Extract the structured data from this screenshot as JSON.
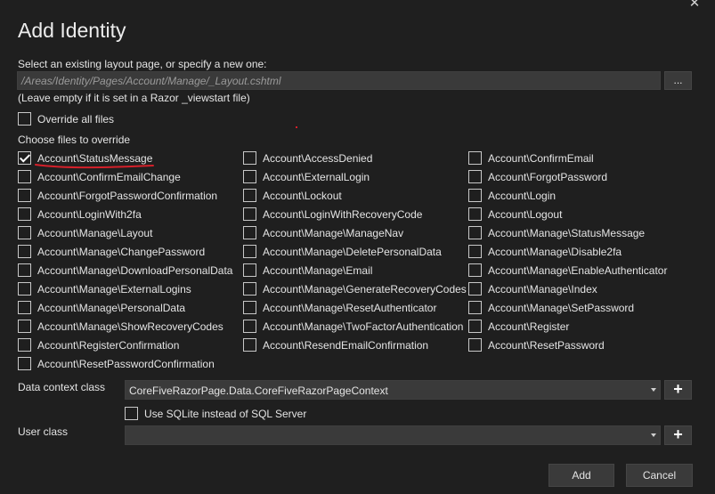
{
  "dialog": {
    "title": "Add Identity",
    "close_glyph": "✕"
  },
  "layout": {
    "label": "Select an existing layout page, or specify a new one:",
    "value": "/Areas/Identity/Pages/Account/Manage/_Layout.cshtml",
    "browse_label": "...",
    "hint": "(Leave empty if it is set in a Razor _viewstart file)"
  },
  "override_all": {
    "label": "Override all files",
    "checked": false
  },
  "choose_label": "Choose files to override",
  "files": [
    {
      "label": "Account\\StatusMessage",
      "checked": true
    },
    {
      "label": "Account\\AccessDenied",
      "checked": false
    },
    {
      "label": "Account\\ConfirmEmail",
      "checked": false
    },
    {
      "label": "Account\\ConfirmEmailChange",
      "checked": false
    },
    {
      "label": "Account\\ExternalLogin",
      "checked": false
    },
    {
      "label": "Account\\ForgotPassword",
      "checked": false
    },
    {
      "label": "Account\\ForgotPasswordConfirmation",
      "checked": false
    },
    {
      "label": "Account\\Lockout",
      "checked": false
    },
    {
      "label": "Account\\Login",
      "checked": false
    },
    {
      "label": "Account\\LoginWith2fa",
      "checked": false
    },
    {
      "label": "Account\\LoginWithRecoveryCode",
      "checked": false
    },
    {
      "label": "Account\\Logout",
      "checked": false
    },
    {
      "label": "Account\\Manage\\Layout",
      "checked": false
    },
    {
      "label": "Account\\Manage\\ManageNav",
      "checked": false
    },
    {
      "label": "Account\\Manage\\StatusMessage",
      "checked": false
    },
    {
      "label": "Account\\Manage\\ChangePassword",
      "checked": false
    },
    {
      "label": "Account\\Manage\\DeletePersonalData",
      "checked": false
    },
    {
      "label": "Account\\Manage\\Disable2fa",
      "checked": false
    },
    {
      "label": "Account\\Manage\\DownloadPersonalData",
      "checked": false
    },
    {
      "label": "Account\\Manage\\Email",
      "checked": false
    },
    {
      "label": "Account\\Manage\\EnableAuthenticator",
      "checked": false
    },
    {
      "label": "Account\\Manage\\ExternalLogins",
      "checked": false
    },
    {
      "label": "Account\\Manage\\GenerateRecoveryCodes",
      "checked": false
    },
    {
      "label": "Account\\Manage\\Index",
      "checked": false
    },
    {
      "label": "Account\\Manage\\PersonalData",
      "checked": false
    },
    {
      "label": "Account\\Manage\\ResetAuthenticator",
      "checked": false
    },
    {
      "label": "Account\\Manage\\SetPassword",
      "checked": false
    },
    {
      "label": "Account\\Manage\\ShowRecoveryCodes",
      "checked": false
    },
    {
      "label": "Account\\Manage\\TwoFactorAuthentication",
      "checked": false
    },
    {
      "label": "Account\\Register",
      "checked": false
    },
    {
      "label": "Account\\RegisterConfirmation",
      "checked": false
    },
    {
      "label": "Account\\ResendEmailConfirmation",
      "checked": false
    },
    {
      "label": "Account\\ResetPassword",
      "checked": false
    },
    {
      "label": "Account\\ResetPasswordConfirmation",
      "checked": false
    }
  ],
  "data_context": {
    "label": "Data context class",
    "value": "CoreFiveRazorPage.Data.CoreFiveRazorPageContext",
    "add_label": "+"
  },
  "sqlite": {
    "label": "Use SQLite instead of SQL Server",
    "checked": false
  },
  "user_class": {
    "label": "User class",
    "value": "",
    "add_label": "+"
  },
  "actions": {
    "add_label": "Add",
    "cancel_label": "Cancel"
  },
  "colors": {
    "background": "#1f1f1f",
    "input_background": "#3a3a3a",
    "annotation_red": "#d4202a"
  }
}
